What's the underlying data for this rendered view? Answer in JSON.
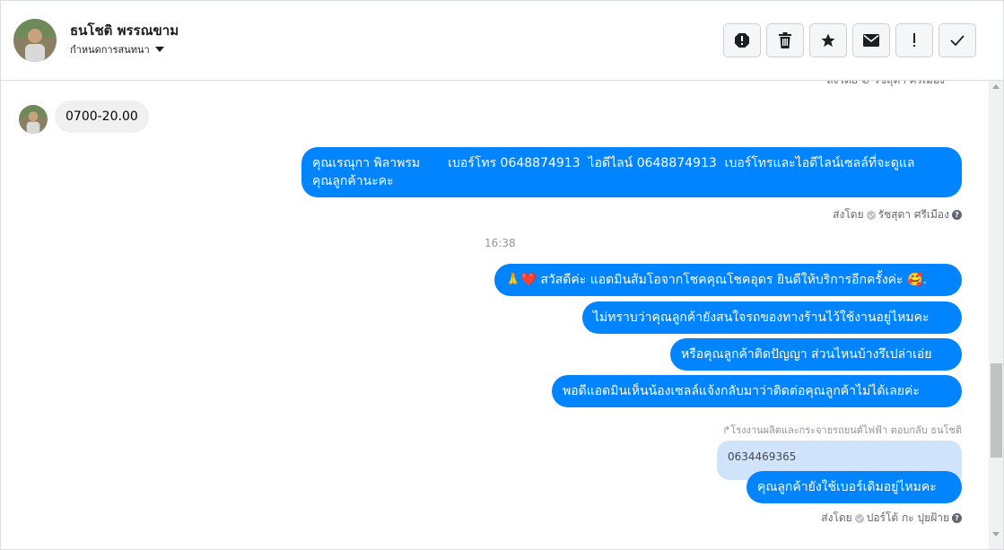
{
  "header": {
    "contact_name": "ธนโชติ พรรณขาม",
    "assign_label": "กำหนดการสนทนา",
    "actions": [
      {
        "name": "spam-icon",
        "glyph": "!"
      },
      {
        "name": "trash-icon",
        "glyph": "🗑"
      },
      {
        "name": "star-icon",
        "glyph": "★"
      },
      {
        "name": "envelope-icon",
        "glyph": "✉"
      },
      {
        "name": "important-icon",
        "glyph": "!"
      },
      {
        "name": "check-icon",
        "glyph": "✓"
      }
    ]
  },
  "thread": {
    "clipped_meta": "ส่งโดย ⊘ รัชสุดา ศรีเมือง",
    "incoming": {
      "text": "0700-20.00"
    },
    "out1": {
      "line1": "คุณเรณุกา พิลาพรม       เบอร์โทร 0648874913  ไอดีไลน์ 0648874913  เบอร์โทรและไอดีไลน์เซลล์ที่จะดูแล",
      "line2": "คุณลูกค้านะคะ"
    },
    "meta1": {
      "prefix": "ส่งโดย",
      "agent": "รัชสุดา ศรีเมือง"
    },
    "time": "16:38",
    "out2": {
      "emoji_pray": "🙏",
      "emoji_heart": "❤️",
      "text": "สวัสดีค่ะ แอดมินส้มโอจากโชคคุณโชคอุดร ยินดีให้บริการอีกครั้งค่ะ ",
      "emoji_face": "🥰",
      "tail": "."
    },
    "out3": "ไม่ทราบว่าคุณลูกค้ายังสนใจรถของทางร้านไว้ใช้งานอยู่ไหมคะ",
    "out4": "หรือคุณลูกค้าติดปัญญา ส่วนไหนบ้างรึเปล่าเอ่ย",
    "out5": "พอดีแอดมินเห็นน้องเซลล์แจ้งกลับมาว่าติดต่อคุณลูกค้าไม่ได้เลยค่ะ",
    "reply_note": "↱โรงงานผลิตและกระจายรถยนต์ไฟฟ้า ตอบกลับ ธนโชติ",
    "quoted": "0634469365",
    "out6": "คุณลูกค้ายังใช้เบอร์เดิมอยู่ไหมคะ",
    "meta2": {
      "prefix": "ส่งโดย",
      "agent": "ปอร์โต้ กะ ปุยฝ้าย"
    }
  },
  "colors": {
    "outgoing_bubble": "#0084ff",
    "incoming_bubble": "#f0f0f0",
    "quoted_bubble": "#cfe4fb"
  }
}
